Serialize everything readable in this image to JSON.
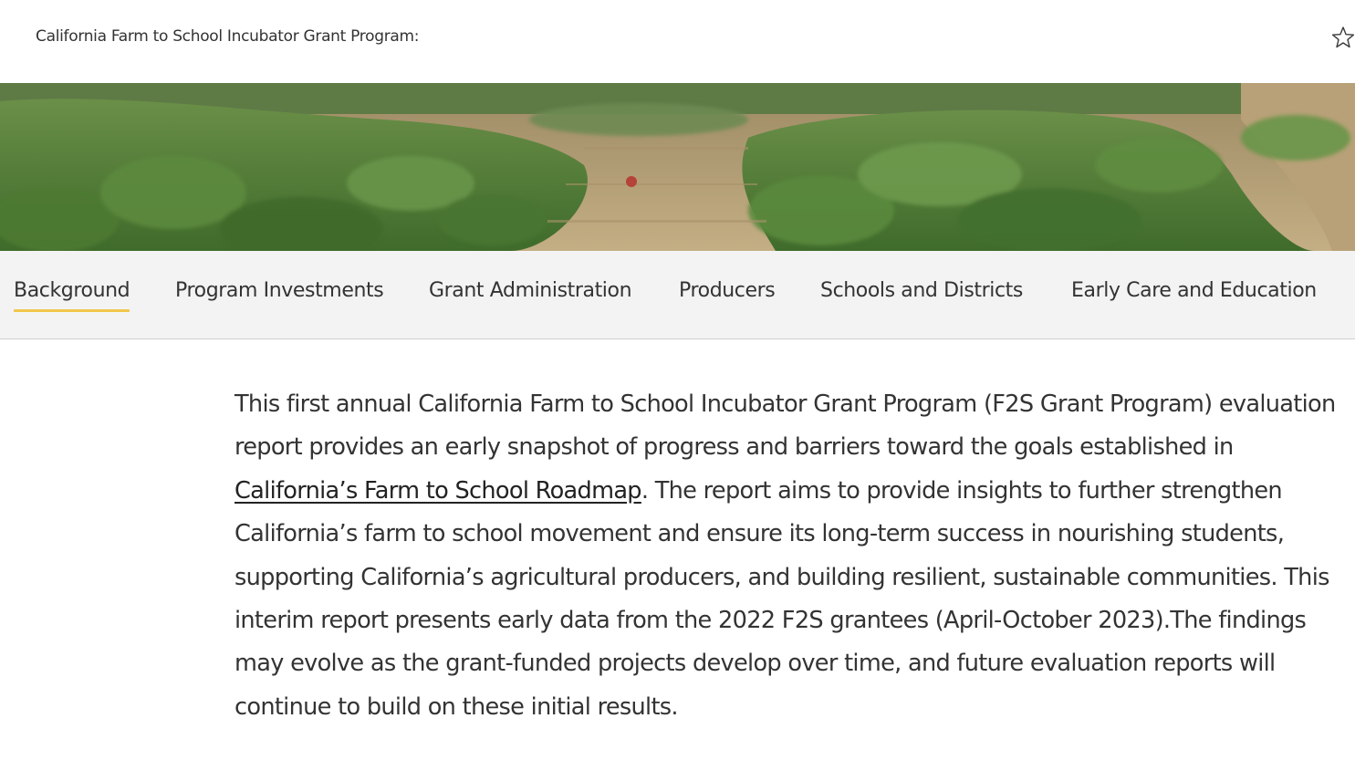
{
  "header": {
    "title": "California Farm to School Incubator Grant Program:",
    "bookmark_icon": "star-outline-icon"
  },
  "hero": {
    "image": "strawberry-field-photo",
    "colors": {
      "foliage": "#4f7a34",
      "soil": "#b9a27a"
    }
  },
  "tabs": [
    {
      "label": "Background",
      "active": true
    },
    {
      "label": "Program Investments",
      "active": false
    },
    {
      "label": "Grant Administration",
      "active": false
    },
    {
      "label": "Producers",
      "active": false
    },
    {
      "label": "Schools and Districts",
      "active": false
    },
    {
      "label": "Early Care and Education",
      "active": false
    }
  ],
  "colors": {
    "active_tab_underline": "#f0c64a",
    "tab_bar_bg": "#f3f3f3",
    "text": "#333333"
  },
  "content": {
    "text_before_link": "This first annual California Farm to School Incubator Grant Program (F2S Grant Program) evaluation report provides an early snapshot of progress and barriers toward the goals established in ",
    "link_text": "California’s Farm to School Roadmap",
    "text_after_link": ". The report aims to provide insights to further strengthen California’s farm to school movement and ensure its long-term success in nourishing students, supporting California’s agricultural producers, and building resilient, sustainable communities. This interim report presents early data from the 2022 F2S grantees (April-October 2023).The findings may evolve as the grant-funded projects develop over time, and future evaluation reports will continue to build on these initial results."
  }
}
